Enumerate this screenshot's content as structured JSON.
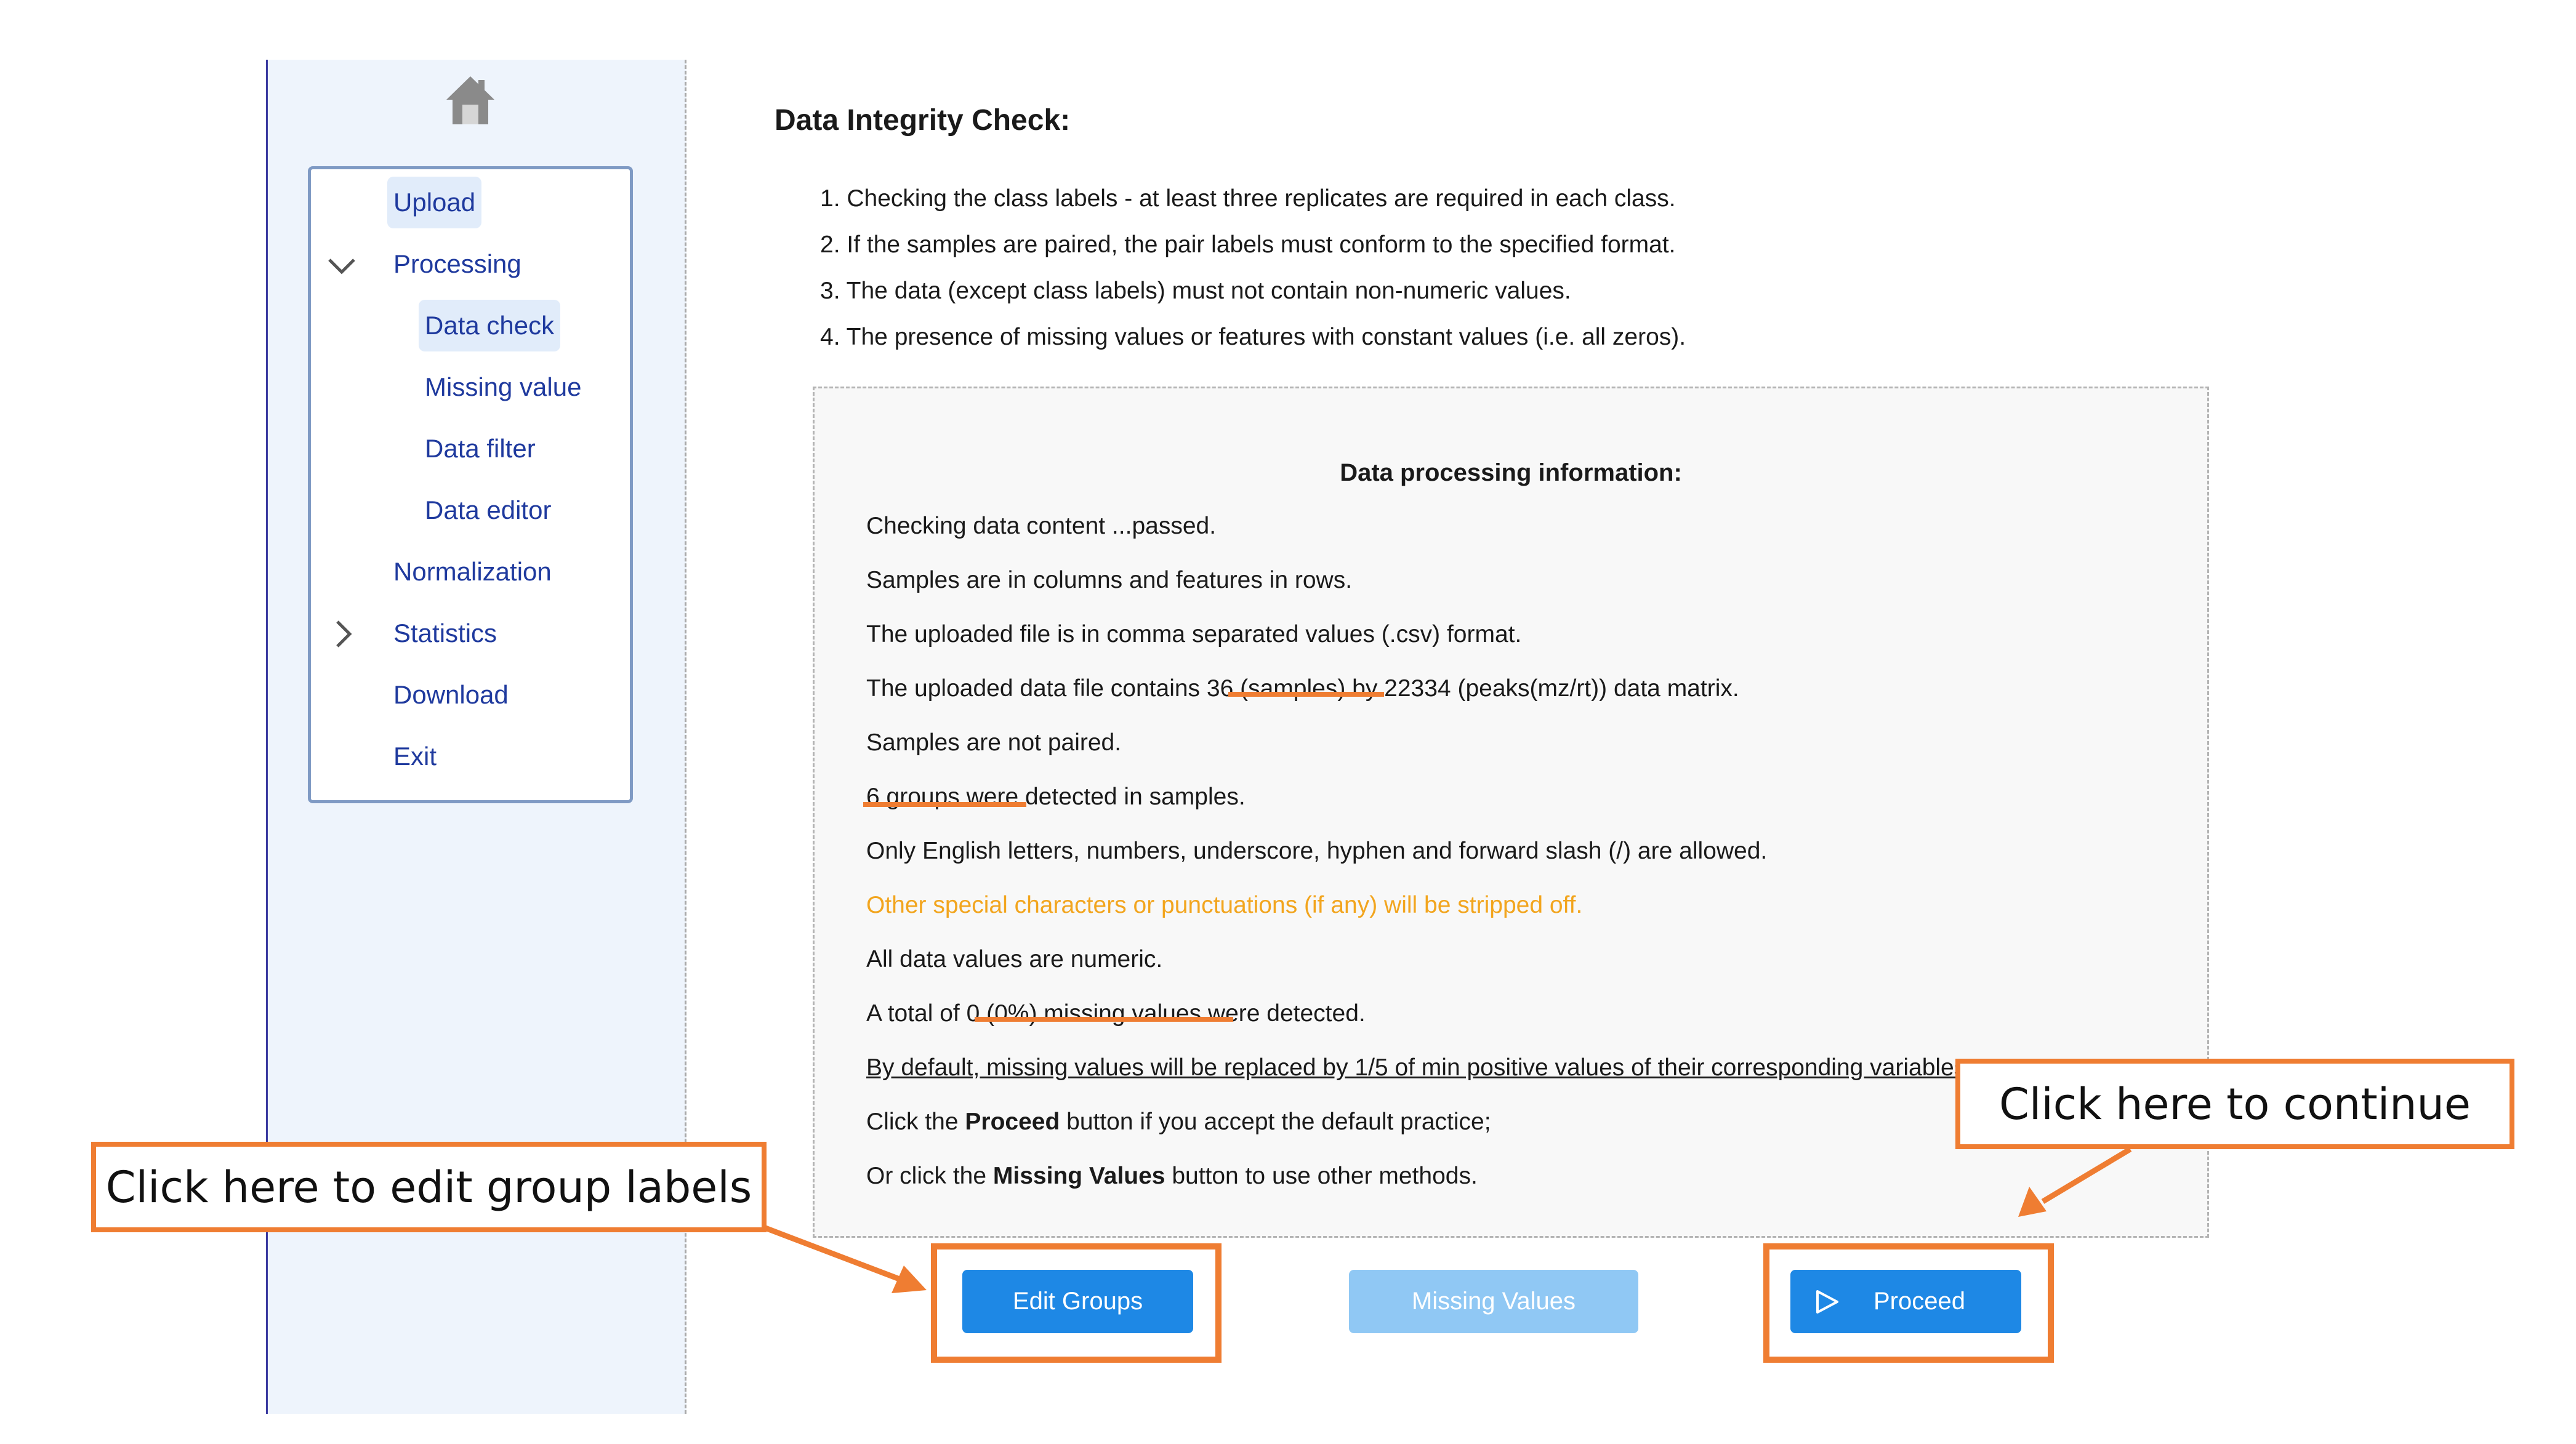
{
  "sidebar": {
    "home_icon": "home-icon",
    "items": [
      {
        "label": "Upload"
      },
      {
        "label": "Processing"
      },
      {
        "label": "Data check"
      },
      {
        "label": "Missing value"
      },
      {
        "label": "Data filter"
      },
      {
        "label": "Data editor"
      },
      {
        "label": "Normalization"
      },
      {
        "label": "Statistics"
      },
      {
        "label": "Download"
      },
      {
        "label": "Exit"
      }
    ]
  },
  "main": {
    "title": "Data Integrity Check:",
    "checklist": [
      "1. Checking the class labels - at least three replicates are required in each class.",
      "2. If the samples are paired, the pair labels must conform to the specified format.",
      "3. The data (except class labels) must not contain non-numeric values.",
      "4. The presence of missing values or features with constant values (i.e. all zeros)."
    ],
    "info": {
      "title": "Data processing information:",
      "line1": "Checking data content ...passed.",
      "line2": "Samples are in columns and features in rows.",
      "line3": "The uploaded file is in comma separated values (.csv) format.",
      "line4": "The uploaded data file contains 36 (samples) by 22334 (peaks(mz/rt)) data matrix.",
      "line5": "Samples are not paired.",
      "line6": "6 groups were detected in samples.",
      "line7": "Only English letters, numbers, underscore, hyphen and forward slash (/) are allowed.",
      "line8_warning": "Other special characters or punctuations (if any) will be stripped off.",
      "line9": "All data values are numeric.",
      "line10": "A total of 0 (0%) missing values were detected.",
      "line11": "By default, missing values will be replaced by 1/5 of min positive values of their corresponding variables",
      "line12_pre": "Click the ",
      "line12_bold": "Proceed",
      "line12_post": " button if you accept the default practice;",
      "line13_pre": "Or click the ",
      "line13_bold": "Missing Values",
      "line13_post": " button to use other methods."
    },
    "buttons": {
      "edit_groups": "Edit Groups",
      "missing_values": "Missing Values",
      "proceed": "Proceed"
    }
  },
  "annotations": {
    "edit_callout": "Click here to edit group labels",
    "proceed_callout": "Click here to continue",
    "accent_color": "#ef7d32"
  }
}
